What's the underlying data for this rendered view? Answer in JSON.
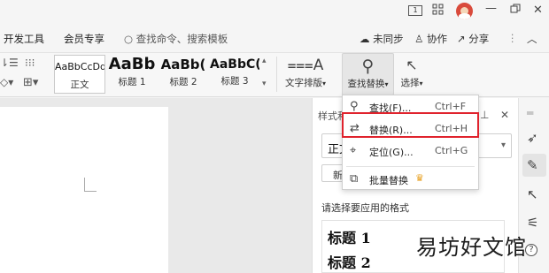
{
  "titlebar": {
    "controls": [
      "1",
      "grid",
      "avatar",
      "minimize",
      "restore",
      "close"
    ]
  },
  "menubar": {
    "tabs": [
      "开发工具",
      "会员专享"
    ],
    "search_placeholder": "查找命令、搜索模板",
    "right_buttons": [
      "未同步",
      "协作",
      "分享"
    ]
  },
  "ribbon": {
    "styles": [
      {
        "sample": "AaBbCcDd",
        "label": "正文"
      },
      {
        "sample": "AaBb",
        "label": "标题 1"
      },
      {
        "sample": "AaBb(",
        "label": "标题 2"
      },
      {
        "sample": "AaBbC(",
        "label": "标题 3"
      }
    ],
    "text_layout": "文字排版",
    "find_replace": "查找替换",
    "select": "选择"
  },
  "dropdown": {
    "items": [
      {
        "icon": "search-icon",
        "label": "查找(F)...",
        "shortcut": "Ctrl+F"
      },
      {
        "icon": "replace-icon",
        "label": "替换(R)...",
        "shortcut": "Ctrl+H"
      },
      {
        "icon": "goto-icon",
        "label": "定位(G)...",
        "shortcut": "Ctrl+G"
      },
      {
        "icon": "batch-replace-icon",
        "label": "批量替换",
        "shortcut": ""
      }
    ],
    "highlight_color": "#e0232d"
  },
  "panel": {
    "title": "样式和",
    "current_style": "正文",
    "new_button": "新",
    "prompt": "请选择要应用的格式",
    "headings": [
      "标题 1",
      "标题 2"
    ]
  },
  "watermark": "易坊好文馆"
}
